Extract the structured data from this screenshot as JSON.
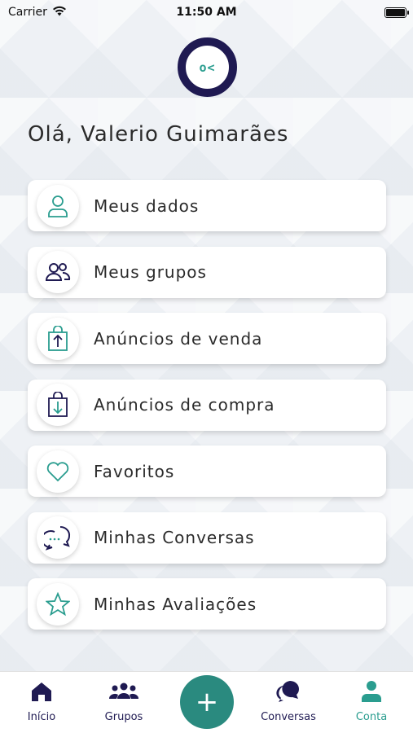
{
  "status_bar": {
    "carrier": "Carrier",
    "time": "11:50 AM"
  },
  "logo": {
    "text": "o<"
  },
  "greeting": "Olá, Valerio Guimarães",
  "menu": [
    {
      "label": "Meus dados",
      "icon": "user-icon"
    },
    {
      "label": "Meus grupos",
      "icon": "users-icon"
    },
    {
      "label": "Anúncios de venda",
      "icon": "bag-up-icon"
    },
    {
      "label": "Anúncios de compra",
      "icon": "bag-down-icon"
    },
    {
      "label": "Favoritos",
      "icon": "heart-icon"
    },
    {
      "label": "Minhas Conversas",
      "icon": "chat-icon"
    },
    {
      "label": "Minhas Avaliações",
      "icon": "star-icon"
    }
  ],
  "tabbar": {
    "tabs": [
      {
        "label": "Início",
        "icon": "home-icon"
      },
      {
        "label": "Grupos",
        "icon": "group-icon"
      },
      {
        "label": "Conversas",
        "icon": "conversation-icon"
      },
      {
        "label": "Conta",
        "icon": "account-icon",
        "active": true
      }
    ],
    "fab_label": "+"
  },
  "colors": {
    "accent": "#2a9d8f",
    "navy": "#1f1a52",
    "fab": "#2a8a7f"
  }
}
